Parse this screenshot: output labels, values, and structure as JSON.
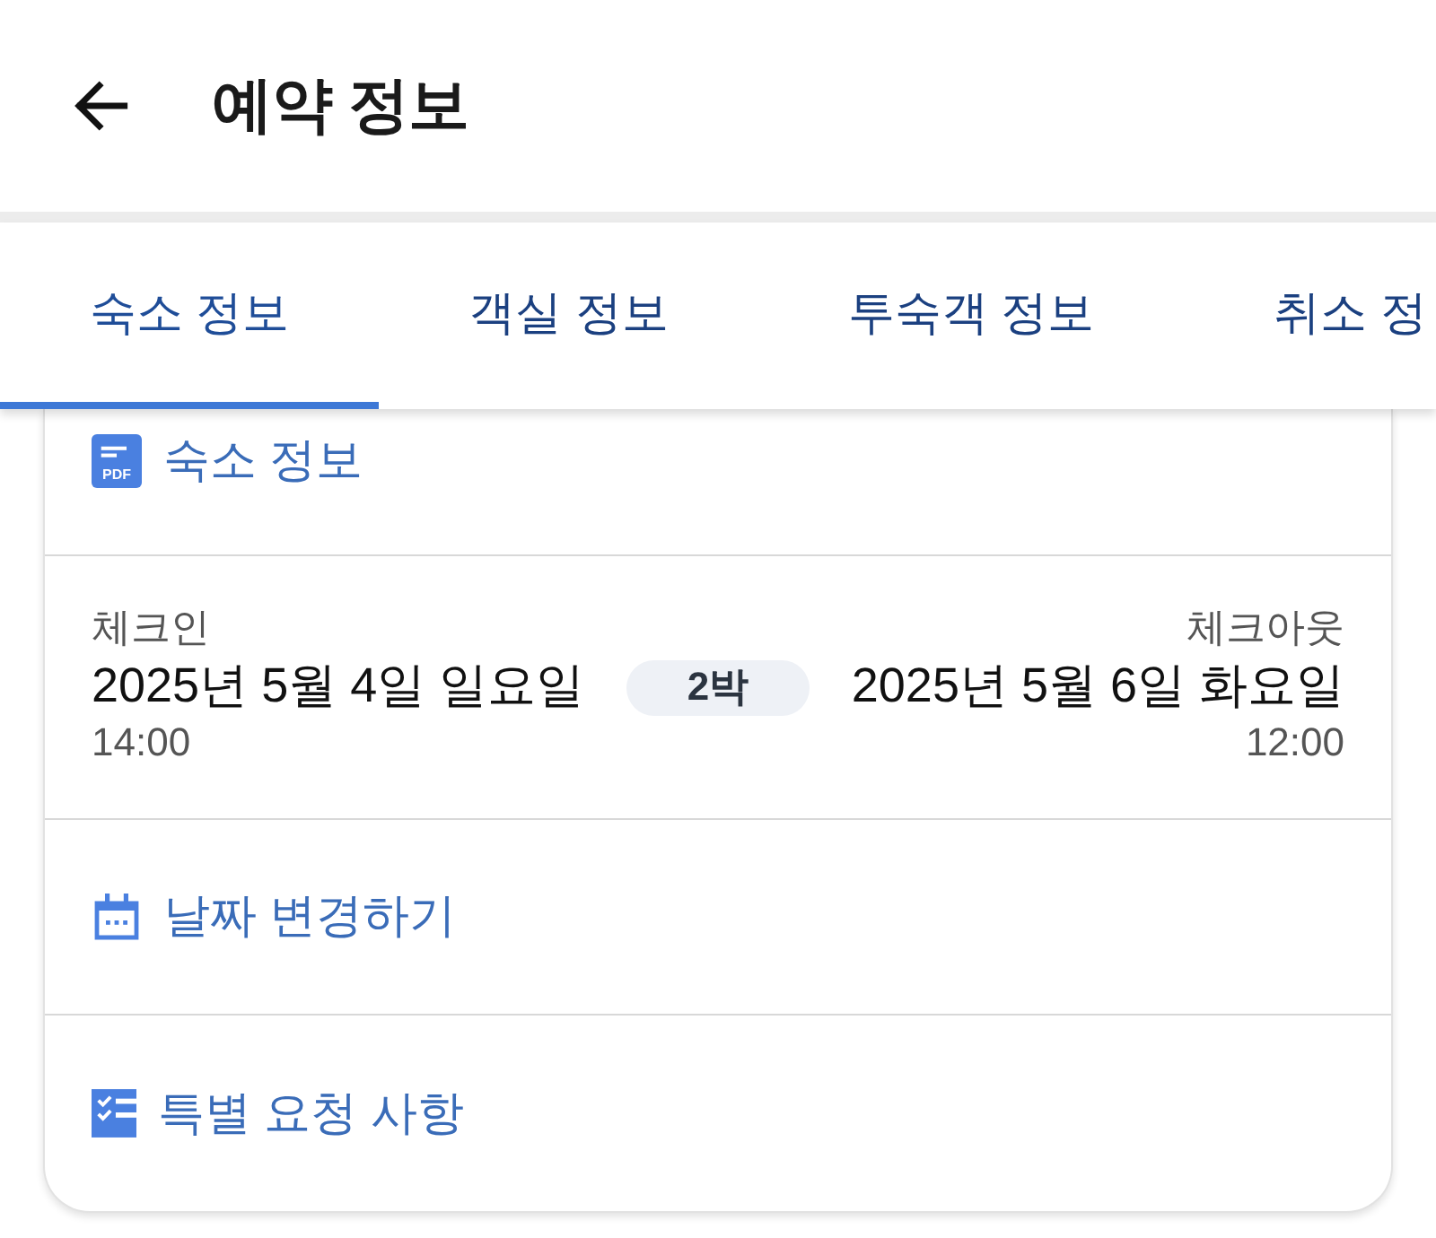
{
  "header": {
    "title": "예약 정보"
  },
  "tabs": [
    {
      "label": "숙소 정보",
      "selected": true
    },
    {
      "label": "객실 정보",
      "selected": false
    },
    {
      "label": "투숙객 정보",
      "selected": false
    },
    {
      "label": "취소 정",
      "selected": false
    }
  ],
  "property_info": {
    "icon_text": "PDF",
    "label": "숙소 정보"
  },
  "stay": {
    "check_in": {
      "label": "체크인",
      "date": "2025년 5월 4일 일요일",
      "time": "14:00"
    },
    "nights": "2박",
    "check_out": {
      "label": "체크아웃",
      "date": "2025년 5월 6일 화요일",
      "time": "12:00"
    }
  },
  "change_dates": {
    "label": "날짜 변경하기"
  },
  "special_requests": {
    "label": "특별 요청 사항"
  }
}
